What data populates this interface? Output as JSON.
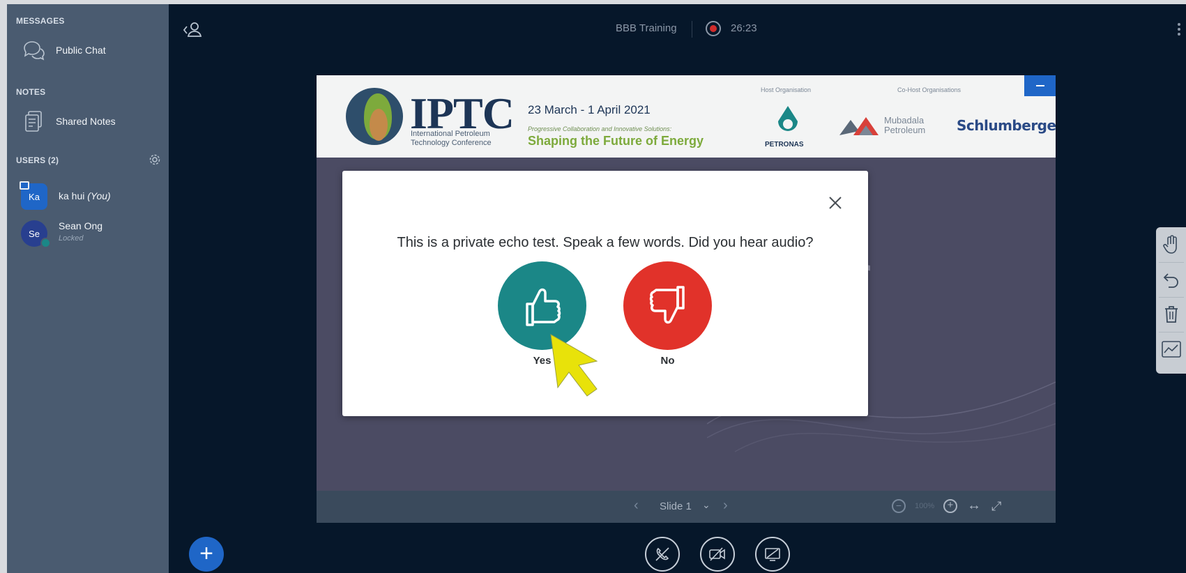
{
  "sidebar": {
    "messages_title": "MESSAGES",
    "public_chat_label": "Public Chat",
    "notes_title": "NOTES",
    "shared_notes_label": "Shared Notes",
    "users_title": "USERS (2)",
    "users": [
      {
        "initials": "Ka",
        "name": "ka hui",
        "you_suffix": "(You)",
        "status": "",
        "color": "#1f66c7"
      },
      {
        "initials": "Se",
        "name": "Sean Ong",
        "you_suffix": "",
        "status": "Locked",
        "color": "#283f8f"
      }
    ]
  },
  "topbar": {
    "meeting_title": "BBB Training",
    "recording_time": "26:23"
  },
  "slide": {
    "logo_text": "IPTC",
    "logo_sub_1": "International Petroleum",
    "logo_sub_2": "Technology Conference",
    "date": "23 March - 1 April 2021",
    "tagline": "Progressive Collaboration and Innovative Solutions:",
    "headline": "Shaping the Future of Energy",
    "host_label": "Host Organisation",
    "cohost_label": "Co-Host Organisations",
    "petronas": "PETRONAS",
    "mubadala_1": "Mubadala",
    "mubadala_2": "Petroleum",
    "schlumberger": "Schlumberger",
    "body_fragment": "r"
  },
  "slide_bar": {
    "slide_label": "Slide 1",
    "zoom": "100%"
  },
  "modal": {
    "question": "This is a private echo test. Speak a few words. Did you hear audio?",
    "yes_label": "Yes",
    "no_label": "No"
  },
  "colors": {
    "yes": "#1b8787",
    "no": "#e1322a",
    "accent": "#1f66c7",
    "main_bg": "#06172a",
    "sidebar_bg": "#4a5b70"
  }
}
